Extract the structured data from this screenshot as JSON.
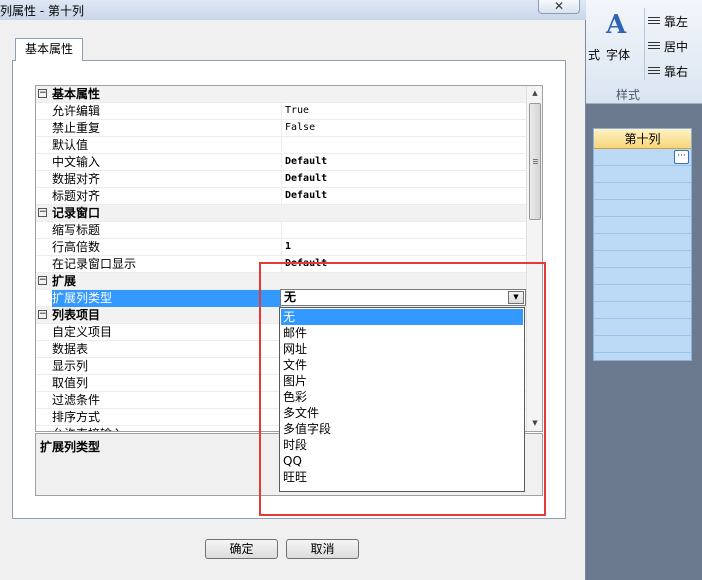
{
  "window": {
    "title": "列属性 - 第十列",
    "close_glyph": "✕"
  },
  "tab": {
    "label": "基本属性"
  },
  "grid": {
    "rows": [
      {
        "kind": "category",
        "label": "基本属性",
        "toggle": "−"
      },
      {
        "kind": "prop",
        "label": "允许编辑",
        "value": "True",
        "bold": false
      },
      {
        "kind": "prop",
        "label": "禁止重复",
        "value": "False",
        "bold": false
      },
      {
        "kind": "prop",
        "label": "默认值",
        "value": "",
        "bold": false
      },
      {
        "kind": "prop",
        "label": "中文输入",
        "value": "Default",
        "bold": true
      },
      {
        "kind": "prop",
        "label": "数据对齐",
        "value": "Default",
        "bold": true
      },
      {
        "kind": "prop",
        "label": "标题对齐",
        "value": "Default",
        "bold": true
      },
      {
        "kind": "category",
        "label": "记录窗口",
        "toggle": "−"
      },
      {
        "kind": "prop",
        "label": "缩写标题",
        "value": "",
        "bold": false
      },
      {
        "kind": "prop",
        "label": "行高倍数",
        "value": "1",
        "bold": true
      },
      {
        "kind": "prop",
        "label": "在记录窗口显示",
        "value": "Default",
        "bold": true
      },
      {
        "kind": "category",
        "label": "扩展",
        "toggle": "−"
      },
      {
        "kind": "prop",
        "label": "扩展列类型",
        "value": "",
        "bold": false,
        "selected": true
      },
      {
        "kind": "category",
        "label": "列表项目",
        "toggle": "−"
      },
      {
        "kind": "prop",
        "label": "自定义项目",
        "value": "",
        "bold": false
      },
      {
        "kind": "prop",
        "label": "数据表",
        "value": "",
        "bold": false
      },
      {
        "kind": "prop",
        "label": "显示列",
        "value": "",
        "bold": false
      },
      {
        "kind": "prop",
        "label": "取值列",
        "value": "",
        "bold": false
      },
      {
        "kind": "prop",
        "label": "过滤条件",
        "value": "",
        "bold": false
      },
      {
        "kind": "prop",
        "label": "排序方式",
        "value": "",
        "bold": false
      },
      {
        "kind": "prop",
        "label": "允许直接输入",
        "value": "",
        "bold": false
      }
    ]
  },
  "scrollbar": {
    "up": "▲",
    "down": "▼"
  },
  "combo": {
    "value": "无",
    "arrow": "▼"
  },
  "dropdown": {
    "options": [
      "无",
      "邮件",
      "网址",
      "文件",
      "图片",
      "色彩",
      "多文件",
      "多值字段",
      "时段",
      "QQ",
      "旺旺"
    ],
    "selected_index": 0
  },
  "description": {
    "title": "扩展列类型"
  },
  "buttons": {
    "ok": "确定",
    "cancel": "取消"
  },
  "background_app": {
    "font_glyph": "A",
    "font_label": "字体",
    "partial_label": "式",
    "align_left": "靠左",
    "align_center": "居中",
    "align_right": "靠右",
    "group_label": "样式",
    "column_header": "第十列",
    "ellipsis": "···"
  },
  "colors": {
    "selection": "#3399ff",
    "highlight_box": "#e33a3a",
    "grid_bg": "#bcd9f6"
  }
}
